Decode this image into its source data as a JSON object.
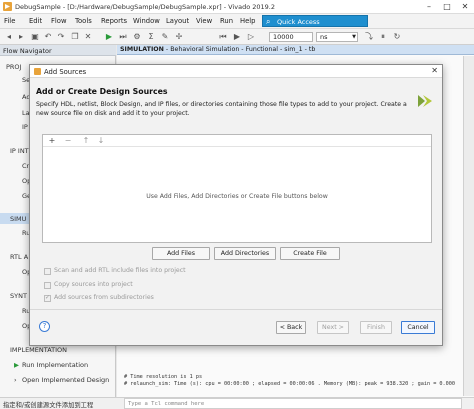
{
  "window": {
    "title": "DebugSample - [D:/Hardware/DebugSample/DebugSample.xpr] - Vivado 2019.2"
  },
  "menu": [
    {
      "label": "File"
    },
    {
      "label": "Edit"
    },
    {
      "label": "Flow"
    },
    {
      "label": "Tools"
    },
    {
      "label": "Reports"
    },
    {
      "label": "Window"
    },
    {
      "label": "Layout"
    },
    {
      "label": "View"
    },
    {
      "label": "Run"
    },
    {
      "label": "Help"
    }
  ],
  "quick_access": {
    "label": "Quick Access"
  },
  "toolbar": {
    "run_time": "10000",
    "time_unit": "ns"
  },
  "flow_navigator": {
    "title": "Flow Navigator",
    "visible_fragments": [
      {
        "label": "PROJ"
      },
      {
        "label": "Se"
      },
      {
        "label": "Ad"
      },
      {
        "label": "La"
      },
      {
        "label": "IP"
      },
      {
        "label": "IP INT"
      },
      {
        "label": "Cr"
      },
      {
        "label": "Op"
      },
      {
        "label": "Ge"
      },
      {
        "label": "SIMU"
      },
      {
        "label": "Ru"
      },
      {
        "label": "RTL A"
      },
      {
        "label": "Op"
      },
      {
        "label": "SYNT"
      },
      {
        "label": "Ru"
      },
      {
        "label": "Op"
      }
    ],
    "implementation": {
      "label": "IMPLEMENTATION",
      "run": "Run Implementation",
      "open": "Open Implemented Design"
    }
  },
  "simulation_panel": {
    "title_bold": "SIMULATION",
    "title_rest": " - Behavioral Simulation - Functional - sim_1 - tb"
  },
  "console": {
    "lines": [
      "# Time resolution is 1 ps",
      "# relaunch_sim: Time (s): cpu = 00:00:00 ; elapsed = 00:00:06 . Memory (MB): peak = 938.320 ; gain = 0.000"
    ],
    "placeholder": "Type a Tcl command here"
  },
  "status_bar": {
    "text": "指定和/或创建源文件添加到工程"
  },
  "dialog": {
    "title": "Add Sources",
    "heading": "Add or Create Design Sources",
    "description": "Specify HDL, netlist, Block Design, and IP files, or directories containing those file types to add to your project. Create a new source file on disk and add it to your project.",
    "empty_hint": "Use Add Files, Add Directories or Create File buttons below",
    "list_toolbar": {
      "add": "+",
      "remove": "−",
      "up": "↑",
      "down": "↓"
    },
    "buttons": {
      "add_files": "Add Files",
      "add_directories": "Add Directories",
      "create_file": "Create File"
    },
    "options": [
      {
        "label": "Scan and add RTL include files into project",
        "checked": false
      },
      {
        "label": "Copy sources into project",
        "checked": false
      },
      {
        "label": "Add sources from subdirectories",
        "checked": true
      }
    ],
    "nav": {
      "back": "< Back",
      "next": "Next >",
      "finish": "Finish",
      "cancel": "Cancel",
      "help": "?"
    }
  },
  "colors": {
    "accent": "#1f8fcf",
    "selection": "#c8dbf0",
    "header": "#cfe0f3"
  }
}
